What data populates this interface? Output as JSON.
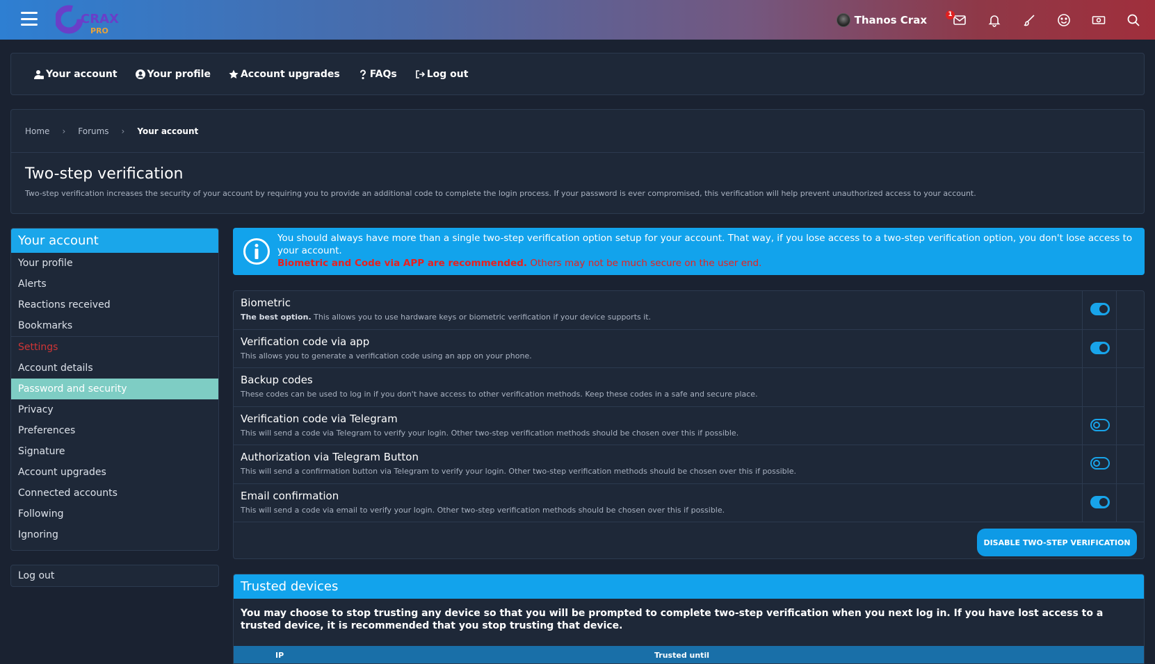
{
  "header": {
    "username": "Thanos Crax",
    "logo_text": "CRAX",
    "logo_sub": "PRO",
    "inbox_badge": "1",
    "icons": [
      "inbox-icon",
      "bell-icon",
      "brush-icon",
      "smiley-icon",
      "cash-icon",
      "search-icon"
    ]
  },
  "account_nav": [
    {
      "label": "Your account",
      "icon": "user-lock-icon"
    },
    {
      "label": "Your profile",
      "icon": "user-circle-icon"
    },
    {
      "label": "Account upgrades",
      "icon": "star-icon"
    },
    {
      "label": "FAQs",
      "icon": "question-icon"
    },
    {
      "label": "Log out",
      "icon": "logout-icon"
    }
  ],
  "breadcrumb": {
    "home": "Home",
    "forums": "Forums",
    "current": "Your account",
    "separator": "›"
  },
  "page": {
    "title": "Two-step verification",
    "description": "Two-step verification increases the security of your account by requiring you to provide an additional code to complete the login process. If your password is ever compromised, this verification will help prevent unauthorized access to your account."
  },
  "sidebar": {
    "title": "Your account",
    "items_top": [
      "Your profile",
      "Alerts",
      "Reactions received",
      "Bookmarks"
    ],
    "section": "Settings",
    "items_settings": [
      "Account details",
      "Password and security",
      "Privacy",
      "Preferences",
      "Signature",
      "Account upgrades",
      "Connected accounts",
      "Following",
      "Ignoring"
    ],
    "active": "Password and security",
    "logout": "Log out"
  },
  "notice": {
    "text": "You should always have more than a single two-step verification option setup for your account. That way, if you lose access to a two-step verification option, you don't lose access to your account.",
    "red_bold": "Biometric and Code via APP are recommended.",
    "red_rest": " Others may not be much secure on the user end."
  },
  "methods": [
    {
      "title": "Biometric",
      "desc_bold": "The best option.",
      "desc": " This allows you to use hardware keys or biometric verification if your device supports it.",
      "toggle": "on"
    },
    {
      "title": "Verification code via app",
      "desc_bold": "",
      "desc": "This allows you to generate a verification code using an app on your phone.",
      "toggle": "on"
    },
    {
      "title": "Backup codes",
      "desc_bold": "",
      "desc": "These codes can be used to log in if you don't have access to other verification methods. Keep these codes in a safe and secure place.",
      "toggle": "none"
    },
    {
      "title": "Verification code via Telegram",
      "desc_bold": "",
      "desc": "This will send a code via Telegram to verify your login. Other two-step verification methods should be chosen over this if possible.",
      "toggle": "off"
    },
    {
      "title": "Authorization via Telegram Button",
      "desc_bold": "",
      "desc": "This will send a confirmation button via Telegram to verify your login. Other two-step verification methods should be chosen over this if possible.",
      "toggle": "off"
    },
    {
      "title": "Email confirmation",
      "desc_bold": "",
      "desc": "This will send a code via email to verify your login. Other two-step verification methods should be chosen over this if possible.",
      "toggle": "on"
    }
  ],
  "disable_button": "DISABLE TWO-STEP VERIFICATION",
  "trusted": {
    "title": "Trusted devices",
    "desc": "You may choose to stop trusting any device so that you will be prompted to complete two-step verification when you next log in. If you have lost access to a trusted device, it is recommended that you stop trusting that device.",
    "col_ip": "IP",
    "col_until": "Trusted until"
  },
  "colors": {
    "accent": "#12a3ec",
    "active_item": "#7ecdc4",
    "warning": "#e8201f",
    "bg": "#1a2231"
  }
}
